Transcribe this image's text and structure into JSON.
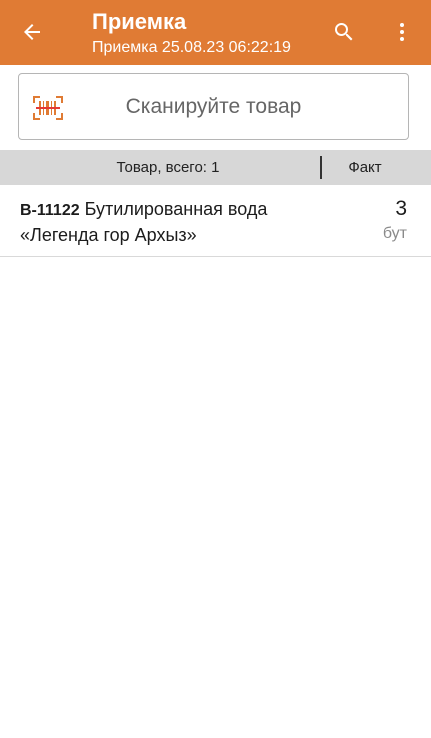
{
  "header": {
    "title": "Приемка",
    "subtitle": "Приемка 25.08.23 06:22:19",
    "back_icon": "arrow-back-icon",
    "search_icon": "search-icon",
    "menu_icon": "more-vert-icon",
    "bg_color": "#e07b34"
  },
  "scan": {
    "label": "Сканируйте товар",
    "icon": "barcode-scan-icon",
    "icon_color": "#e07b34"
  },
  "table": {
    "goods_header": "Товар, всего: 1",
    "fact_header": "Факт",
    "rows": [
      {
        "sku": "B-11122",
        "name": " Бутилированная вода «Легенда гор Архыз»",
        "qty": "3",
        "unit": "бут"
      }
    ]
  }
}
